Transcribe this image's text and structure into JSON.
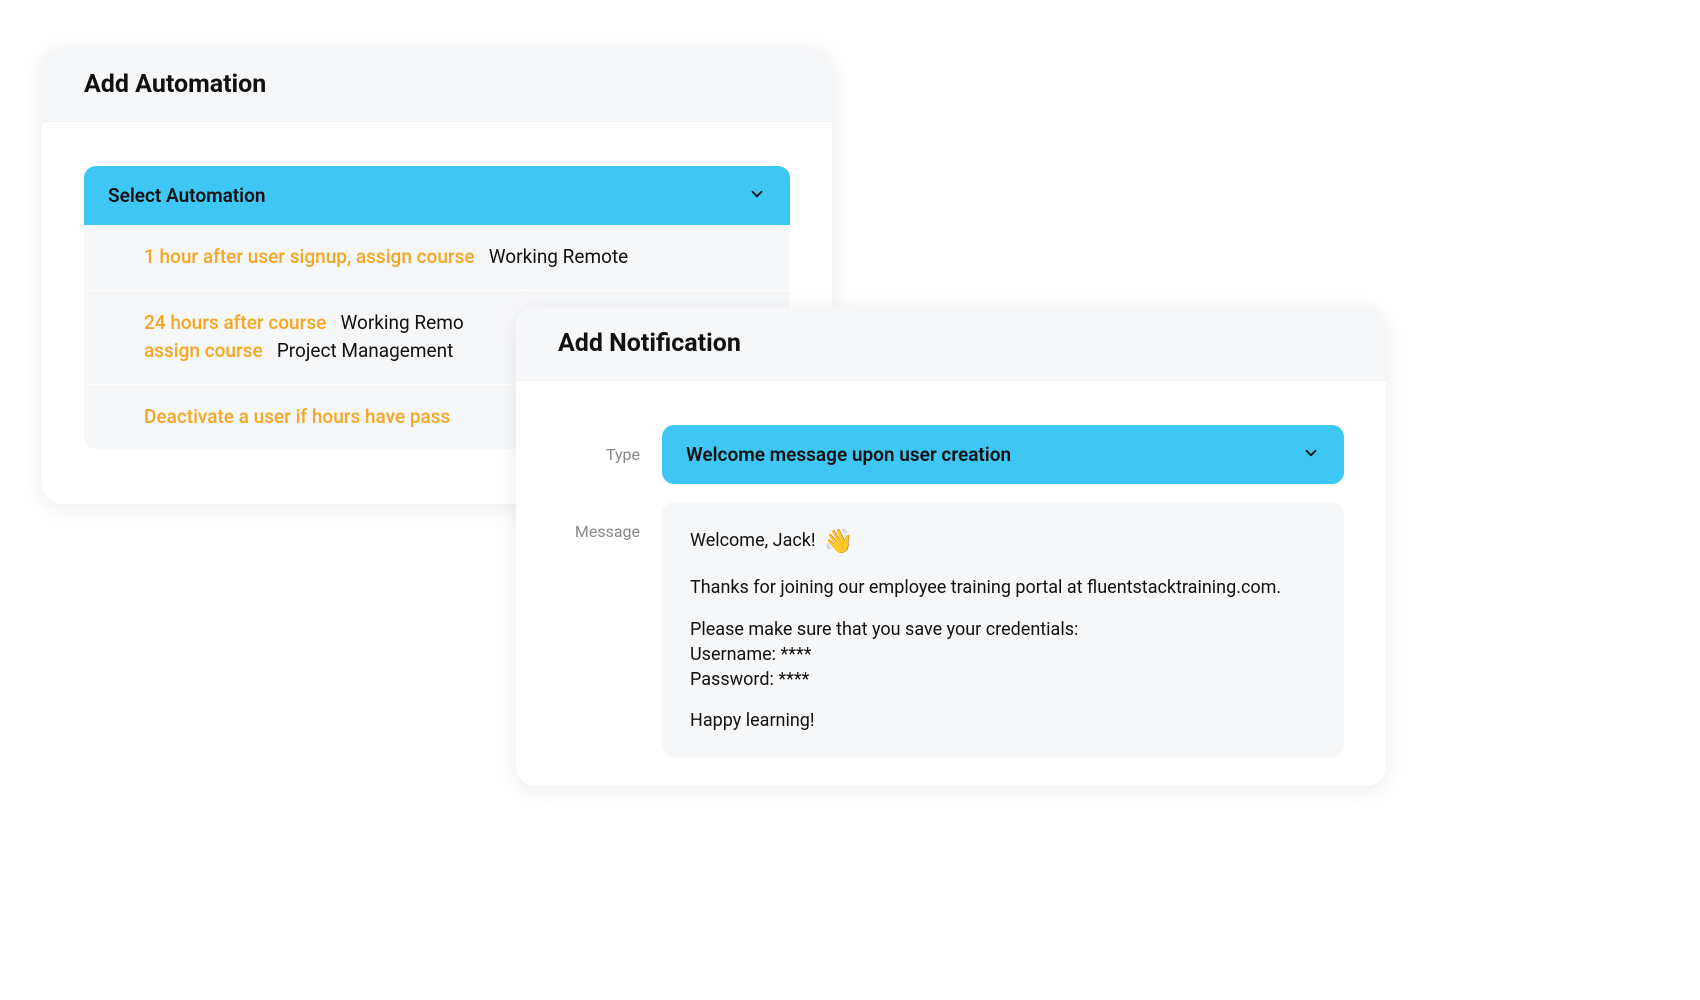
{
  "automation_card": {
    "title": "Add Automation",
    "select_label": "Select Automation",
    "items": [
      {
        "part1_orange": "1 hour after user signup, assign course",
        "part1_black": "Working Remote"
      },
      {
        "part1_orange": "24 hours after course",
        "part1_black": "Working Remo",
        "part2_orange": "assign course",
        "part2_black": "Project Management "
      },
      {
        "part1_orange": "Deactivate a user if",
        "part1_black_orange": "hours have pass"
      }
    ]
  },
  "notification_card": {
    "title": "Add Notification",
    "type_label": "Type",
    "type_selected": "Welcome message upon user creation",
    "message_label": "Message",
    "message": {
      "greeting": "Welcome, Jack!",
      "emoji": "👋",
      "line1": "Thanks for joining our employee training portal at fluentstacktraining.com.",
      "line2": "Please make sure that you save your credentials:",
      "username_line": "Username: ****",
      "password_line": "Password: ****",
      "closing": "Happy learning!"
    }
  }
}
